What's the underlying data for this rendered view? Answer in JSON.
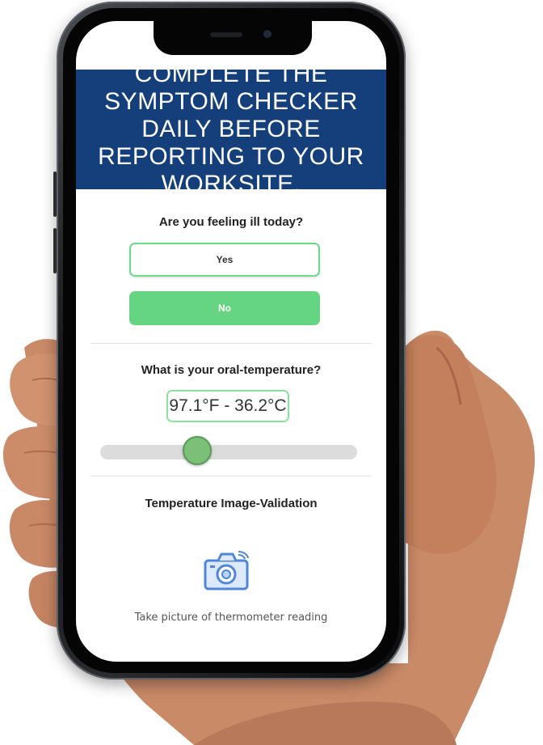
{
  "header": {
    "banner_text": "COMPLETE THE SYMPTOM CHECKER DAILY BEFORE REPORTING TO YOUR WORKSITE."
  },
  "illness_question": {
    "label": "Are you feeling ill today?",
    "options": [
      "Yes",
      "No"
    ],
    "selected": "No"
  },
  "temperature_question": {
    "label": "What is your oral-temperature?",
    "value_display": "97.1°F - 36.2°C",
    "slider_fraction": 0.36
  },
  "image_validation": {
    "label": "Temperature Image-Validation",
    "icon": "camera-icon",
    "caption": "Take picture of thermometer reading"
  },
  "colors": {
    "banner": "#153f7a",
    "accent_green": "#66d582",
    "camera_blue": "#4f86d8"
  }
}
